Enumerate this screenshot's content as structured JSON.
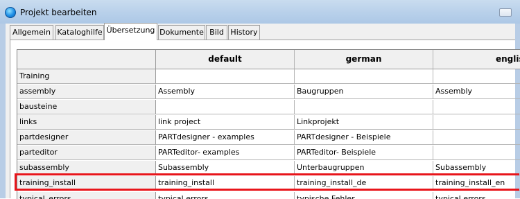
{
  "window": {
    "title": "Projekt bearbeiten"
  },
  "tabs": [
    {
      "label": "Allgemein"
    },
    {
      "label": "Kataloghilfe"
    },
    {
      "label": "Übersetzung"
    },
    {
      "label": "Dokumente"
    },
    {
      "label": "Bild"
    },
    {
      "label": "History"
    }
  ],
  "active_tab": "Übersetzung",
  "table": {
    "columns": [
      "default",
      "german",
      "english"
    ],
    "rows": [
      {
        "key": "Training",
        "default": "",
        "german": "",
        "english": ""
      },
      {
        "key": "assembly",
        "default": "Assembly",
        "german": "Baugruppen",
        "english": "Assembly"
      },
      {
        "key": "bausteine",
        "default": "",
        "german": "",
        "english": ""
      },
      {
        "key": "links",
        "default": "link project",
        "german": "Linkprojekt",
        "english": ""
      },
      {
        "key": "partdesigner",
        "default": "PARTdesigner - examples",
        "german": "PARTdesigner - Beispiele",
        "english": ""
      },
      {
        "key": "parteditor",
        "default": "PARTeditor- examples",
        "german": "PARTeditor- Beispiele",
        "english": ""
      },
      {
        "key": "subassembly",
        "default": "Subassembly",
        "german": "Unterbaugruppen",
        "english": "Subassembly"
      },
      {
        "key": "training_install",
        "default": "training_install",
        "german": "training_install_de",
        "english": "training_install_en"
      },
      {
        "key": "typical_errors",
        "default": "typical errors",
        "german": "typische Fehler",
        "english": "typical errors"
      }
    ]
  },
  "colors": {
    "highlight": "#e8151b",
    "titlebar": "#b8d0ea"
  }
}
